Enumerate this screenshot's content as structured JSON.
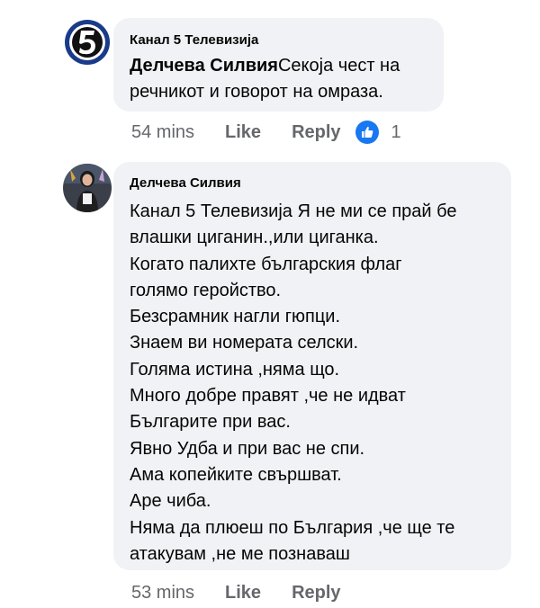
{
  "comments": [
    {
      "author": "Канал 5 Телевизија",
      "mention": "Делчева Силвия",
      "text": "Секоја чест на речникот и говорот на омраза.",
      "time": "54 mins",
      "like_label": "Like",
      "reply_label": "Reply",
      "reaction_icon": "like-reaction-icon",
      "reaction_count": "1"
    },
    {
      "author": "Делчева Силвия",
      "lines": [
        "Канал 5 Телевизија Я не ми се прай бе",
        "влашки циганин.,или циганка.",
        "Когато палихте българския флаг",
        "голямо геройство.",
        "Безсрамник нагли гюпци.",
        "Знаем ви номерата селски.",
        "Голяма истина ,няма що.",
        "Много добре правят ,че не идват",
        "Българите при вас.",
        "Явно Удба и при вас не спи.",
        "Ама копейките свършват.",
        "Аре чиба.",
        "Няма да плюеш по България ,че ще те",
        "атакувам ,не ме познаваш"
      ],
      "time": "53 mins",
      "like_label": "Like",
      "reply_label": "Reply"
    }
  ],
  "colors": {
    "bubble": "#f0f2f5",
    "meta_text": "#65676b",
    "like_blue": "#1877f2",
    "channel_logo_ring": "#1a3b8a"
  }
}
